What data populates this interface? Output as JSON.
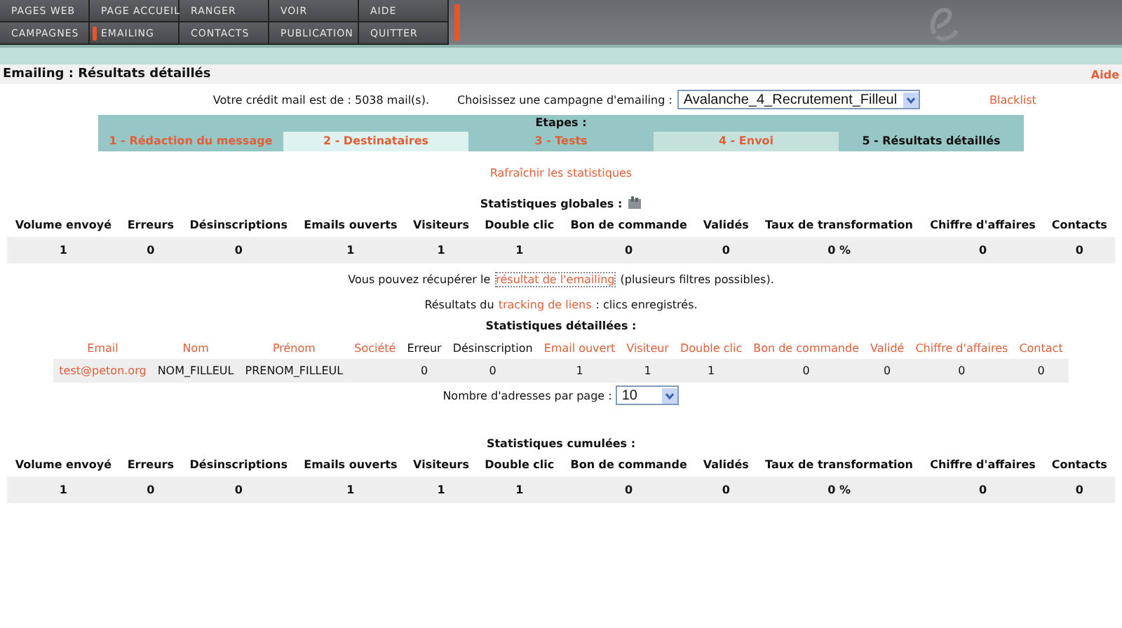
{
  "nav": [
    [
      {
        "label": "PAGES WEB",
        "selected": false
      },
      {
        "label": "PAGE ACCUEIL",
        "selected": false
      },
      {
        "label": "RANGER",
        "selected": false
      },
      {
        "label": "VOIR",
        "selected": false
      },
      {
        "label": "AIDE",
        "selected": false
      }
    ],
    [
      {
        "label": "CAMPAGNES",
        "selected": false
      },
      {
        "label": "EMAILING",
        "selected": true
      },
      {
        "label": "CONTACTS",
        "selected": false
      },
      {
        "label": "PUBLICATION",
        "selected": false
      },
      {
        "label": "QUITTER",
        "selected": false
      }
    ]
  ],
  "page_title": "Emailing : Résultats détaillés",
  "help_link": "Aide",
  "credit": "Votre crédit mail est de : 5038 mail(s).",
  "campaign_label": "Choisissez une campagne d'emailing :",
  "campaign_value": "Avalanche_4_Recrutement_Filleul",
  "blacklist": "Blacklist",
  "steps_title": "Etapes :",
  "steps": [
    {
      "label": "1 - Rédaction du message",
      "selected": false
    },
    {
      "label": "2 - Destinataires",
      "selected": false
    },
    {
      "label": "3 - Tests",
      "selected": false
    },
    {
      "label": "4 - Envoi",
      "selected": false
    },
    {
      "label": "5 - Résultats détaillés",
      "selected": true
    }
  ],
  "refresh": "Rafraîchir les statistiques",
  "global": {
    "title": "Statistiques globales :",
    "columns": [
      "Volume envoyé",
      "Erreurs",
      "Désinscriptions",
      "Emails ouverts",
      "Visiteurs",
      "Double clic",
      "Bon de commande",
      "Validés",
      "Taux de transformation",
      "Chiffre d'affaires",
      "Contacts"
    ],
    "values": [
      "1",
      "0",
      "0",
      "1",
      "1",
      "1",
      "0",
      "0",
      "0 %",
      "0",
      "0"
    ]
  },
  "export_before": "Vous pouvez récupérer le",
  "export_link": "résultat de l'emailing",
  "export_after": "(plusieurs filtres possibles).",
  "tracking_before": "Résultats du",
  "tracking_link": "tracking de liens",
  "tracking_after": ": clics enregistrés.",
  "detailed": {
    "title": "Statistiques détaillées :",
    "columns": [
      {
        "label": "Email",
        "link": true
      },
      {
        "label": "Nom",
        "link": true
      },
      {
        "label": "Prénom",
        "link": true
      },
      {
        "label": "Société",
        "link": true
      },
      {
        "label": "Erreur",
        "link": false
      },
      {
        "label": "Désinscription",
        "link": false
      },
      {
        "label": "Email ouvert",
        "link": true
      },
      {
        "label": "Visiteur",
        "link": true
      },
      {
        "label": "Double clic",
        "link": true
      },
      {
        "label": "Bon de commande",
        "link": true
      },
      {
        "label": "Validé",
        "link": true
      },
      {
        "label": "Chiffre d'affaires",
        "link": true
      },
      {
        "label": "Contact",
        "link": true
      }
    ],
    "rows": [
      [
        {
          "text": "test@peton.org",
          "link": true
        },
        {
          "text": "NOM_FILLEUL",
          "link": false
        },
        {
          "text": "PRENOM_FILLEUL",
          "link": false
        },
        null,
        {
          "text": "0",
          "link": false
        },
        {
          "text": "0",
          "link": false
        },
        {
          "text": "1",
          "link": false
        },
        {
          "text": "1",
          "link": false
        },
        {
          "text": "1",
          "link": false
        },
        {
          "text": "0",
          "link": false
        },
        {
          "text": "0",
          "link": false
        },
        {
          "text": "0",
          "link": false
        },
        {
          "text": "0",
          "link": false
        }
      ]
    ]
  },
  "per_page_label": "Nombre d'adresses par page :",
  "per_page_value": "10",
  "cumulative": {
    "title": "Statistiques cumulées :",
    "columns": [
      "Volume envoyé",
      "Erreurs",
      "Désinscriptions",
      "Emails ouverts",
      "Visiteurs",
      "Double clic",
      "Bon de commande",
      "Validés",
      "Taux de transformation",
      "Chiffre d'affaires",
      "Contacts"
    ],
    "values": [
      "1",
      "0",
      "0",
      "1",
      "1",
      "1",
      "0",
      "0",
      "0 %",
      "0",
      "0"
    ]
  }
}
